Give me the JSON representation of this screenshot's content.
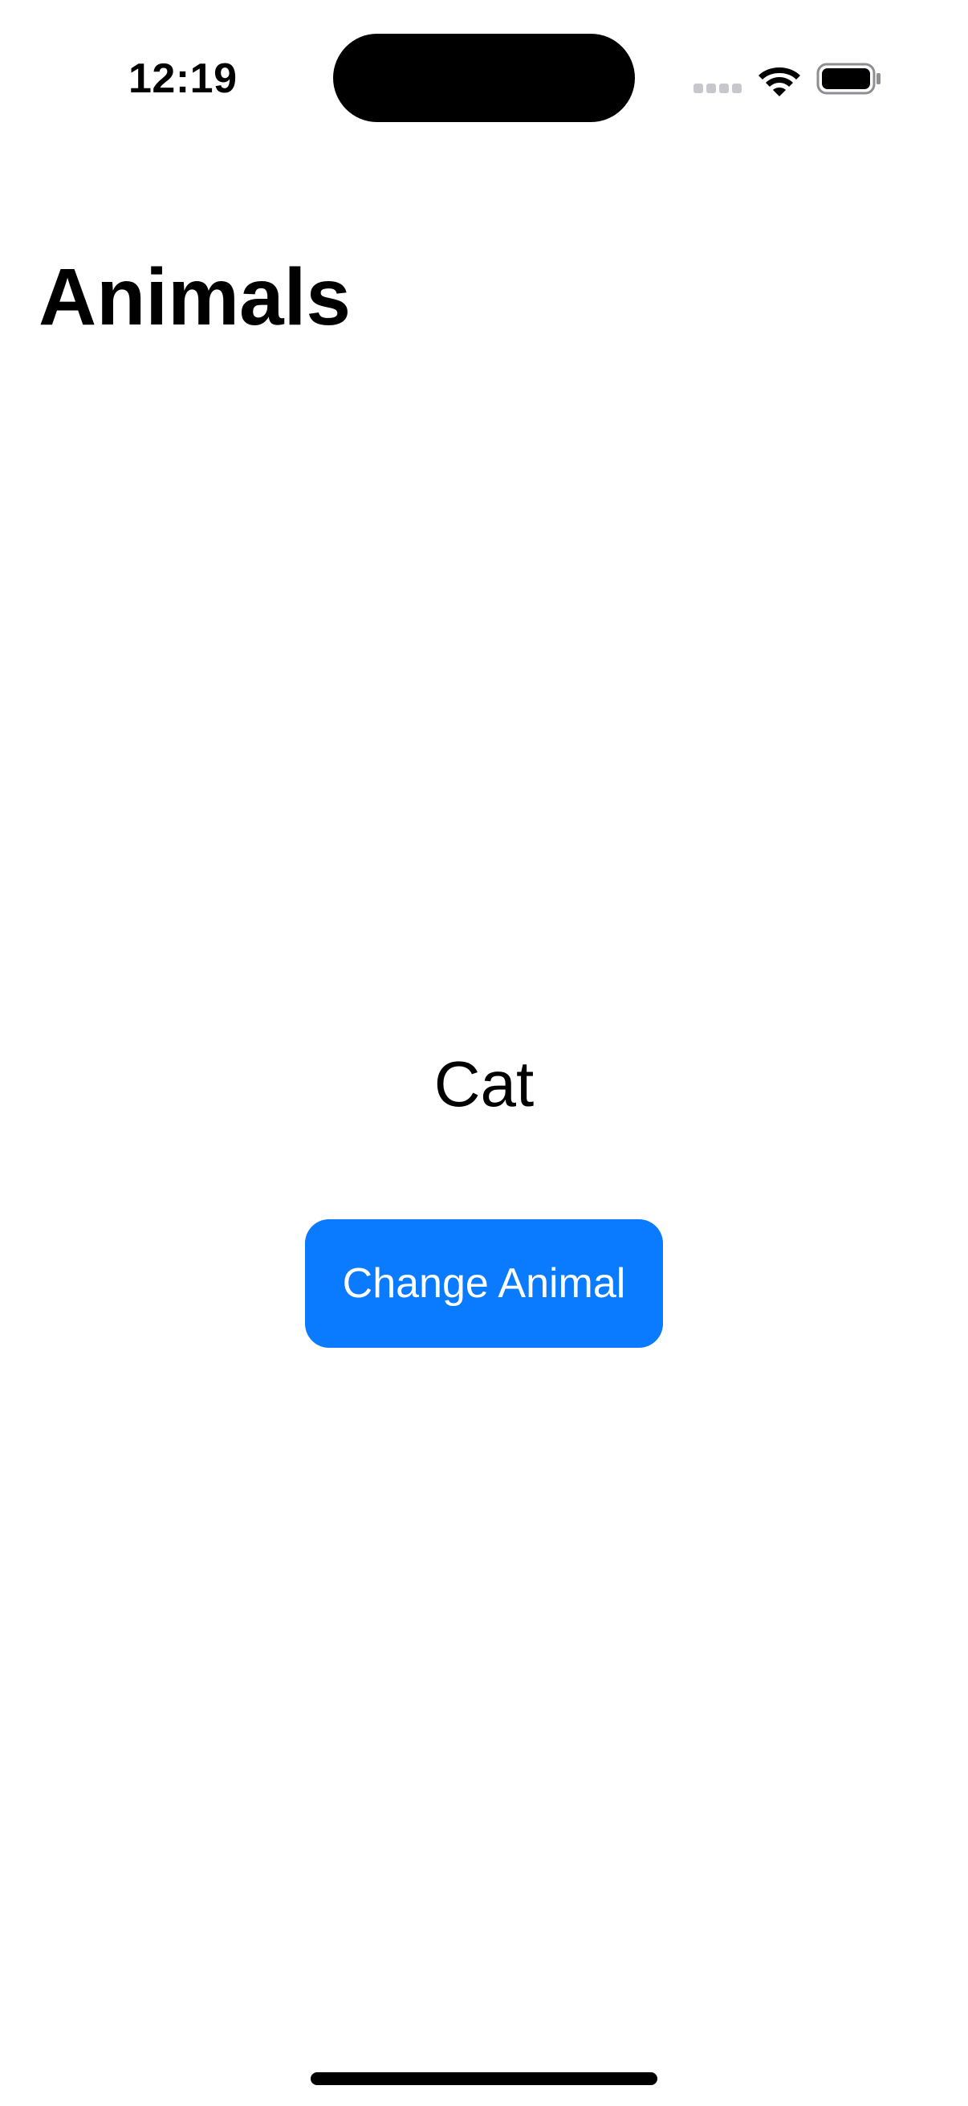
{
  "status_bar": {
    "time": "12:19",
    "icons": [
      "cellular-signal-icon",
      "wifi-icon",
      "battery-icon"
    ]
  },
  "navigation": {
    "title": "Animals"
  },
  "content": {
    "animal_name": "Cat",
    "button_label": "Change Animal"
  },
  "colors": {
    "accent": "#0a7aff",
    "background": "#ffffff",
    "text": "#000000",
    "inactive_signal": "#c7c7cc"
  }
}
